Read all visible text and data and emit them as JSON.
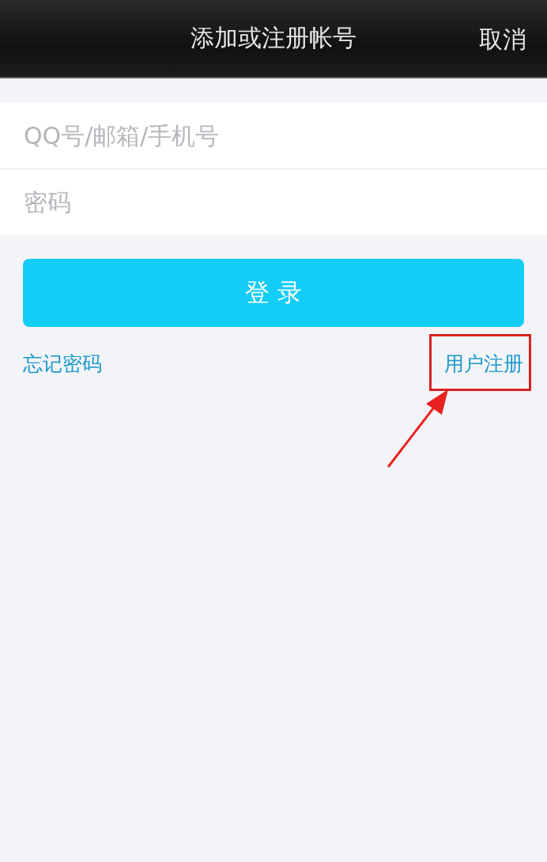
{
  "header": {
    "title": "添加或注册帐号",
    "cancel": "取消"
  },
  "fields": [
    {
      "placeholder": "QQ号/邮箱/手机号"
    },
    {
      "placeholder": "密码"
    }
  ],
  "login_button": "登 录",
  "links": {
    "forgot": "忘记密码",
    "register": "用户注册"
  }
}
